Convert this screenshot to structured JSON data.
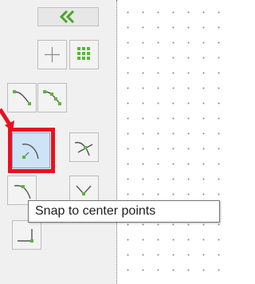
{
  "toolbar": {
    "collapse_icon": "double-chevron-left-icon",
    "buttons": [
      {
        "name": "add-point-button",
        "icon": "plus-icon"
      },
      {
        "name": "snap-grid-button",
        "icon": "grid-dots-icon"
      },
      {
        "name": "snap-endpoints-button",
        "icon": "snap-endpoints-icon"
      },
      {
        "name": "snap-segment-points-button",
        "icon": "snap-points-icon"
      },
      {
        "name": "snap-center-points-button",
        "icon": "snap-center-icon",
        "selected": true
      },
      {
        "name": "snap-intersection-button",
        "icon": "snap-intersection-icon"
      },
      {
        "name": "snap-midpoints-button",
        "icon": "snap-midpoint-icon"
      },
      {
        "name": "snap-perpendicular-button",
        "icon": "snap-perpendicular-icon"
      },
      {
        "name": "snap-line-end-button",
        "icon": "snap-line-end-icon"
      }
    ],
    "accent_color": "#6cc24a",
    "highlight_color": "#e8111d"
  },
  "tooltip": {
    "text": "Snap to center points"
  }
}
